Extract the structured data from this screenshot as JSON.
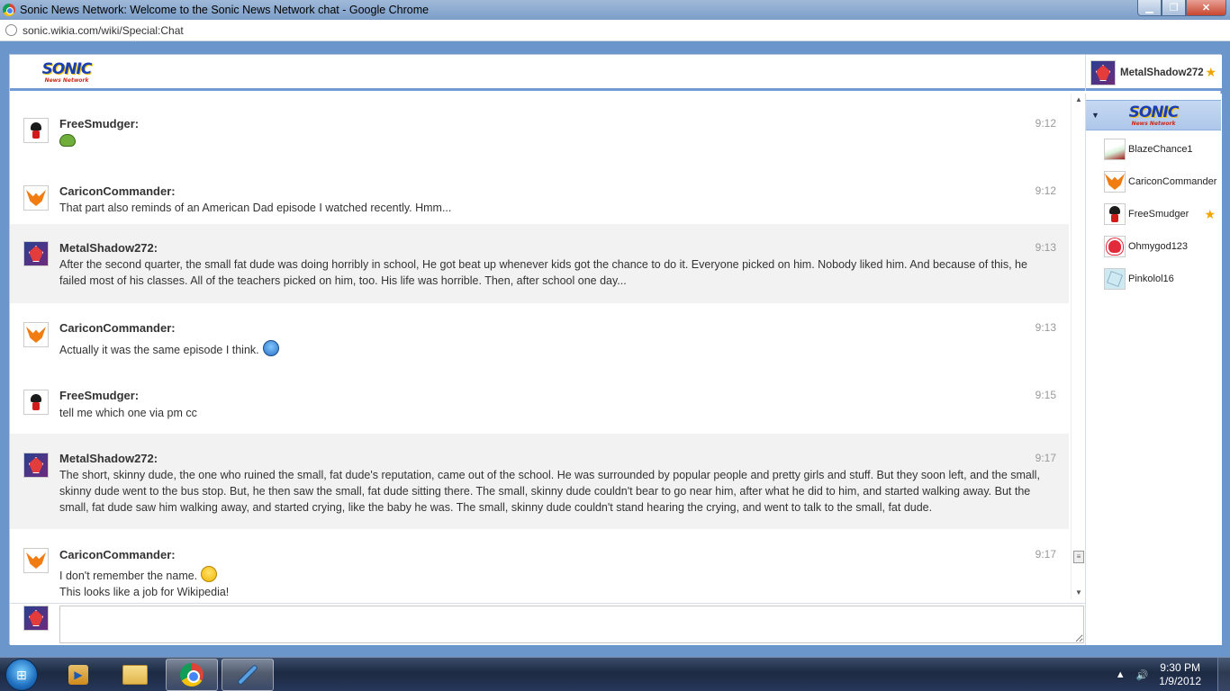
{
  "window": {
    "title": "Sonic News Network: Welcome to the Sonic News Network chat - Google Chrome",
    "min_glyph": "▁",
    "max_glyph": "❐",
    "close_glyph": "✕"
  },
  "address_bar": {
    "url": "sonic.wikia.com/wiki/Special:Chat"
  },
  "header": {
    "logo_big": "SONIC",
    "logo_small": "News Network",
    "current_user": "MetalShadow272",
    "star": "★"
  },
  "messages": [
    {
      "user": "FreeSmudger:",
      "time": "9:12",
      "text": "",
      "emote": "frog",
      "avatar": "free"
    },
    {
      "user": "CariconCommander:",
      "time": "9:12",
      "text": "That part also reminds of an American Dad episode I watched recently. Hmm...",
      "avatar": "caric"
    },
    {
      "user": "MetalShadow272:",
      "time": "9:13",
      "text": "After the second quarter, the small fat dude was doing horribly in school, He got beat up whenever kids got the chance to do it. Everyone picked on him. Nobody liked him. And because of this, he failed most of his classes. All of the teachers picked on him, too. His life was horrible. Then, after school one day...",
      "avatar": "metal"
    },
    {
      "user": "CariconCommander:",
      "time": "9:13",
      "text": "Actually it was the same episode I think.",
      "emote": "blue",
      "avatar": "caric"
    },
    {
      "user": "FreeSmudger:",
      "time": "9:15",
      "text": "tell me which one via pm cc",
      "avatar": "free"
    },
    {
      "user": "MetalShadow272:",
      "time": "9:17",
      "text": "The short, skinny dude, the one who ruined the small, fat dude's reputation, came out of the school. He was surrounded by popular people and pretty girls and stuff. But they soon left, and the small, skinny dude went to the bus stop. But, he then saw the small, fat dude sitting there. The small, skinny dude couldn't bear to go near him, after what he did to him, and started walking away. But the small, fat dude saw him walking away, and started crying, like the baby he was. The small, skinny dude couldn't stand hearing the crying, and went to talk to the small, fat dude.",
      "avatar": "metal"
    },
    {
      "user": "CariconCommander:",
      "time": "9:17",
      "text": "I don't remember the name.",
      "text2": "This looks like a job for Wikipedia!",
      "emote": "yellow",
      "avatar": "caric"
    }
  ],
  "scrollbar": {
    "up_glyph": "▲",
    "down_glyph": "▼",
    "thumb_glyph": "≡"
  },
  "input": {
    "value": "",
    "placeholder": ""
  },
  "userlist": {
    "room_arrow": "▼",
    "logo_big": "SONIC",
    "logo_small": "News Network",
    "users": [
      {
        "name": "BlazeChance1",
        "avatar": "blaze",
        "starred": false
      },
      {
        "name": "CariconCommander",
        "avatar": "caric",
        "starred": false
      },
      {
        "name": "FreeSmudger",
        "avatar": "free",
        "starred": true
      },
      {
        "name": "Ohmygod123",
        "avatar": "ohmy",
        "starred": false
      },
      {
        "name": "Pinkolol16",
        "avatar": "pink",
        "starred": false
      }
    ]
  },
  "taskbar": {
    "start_glyph": "⊞",
    "tray_arrow": "▲",
    "tray_volume": "🔊",
    "time": "9:30 PM",
    "date": "1/9/2012"
  },
  "colors": {
    "header_accent": "#6f9ad6",
    "star": "#f2a400",
    "alt_row": "#f2f2f2"
  }
}
